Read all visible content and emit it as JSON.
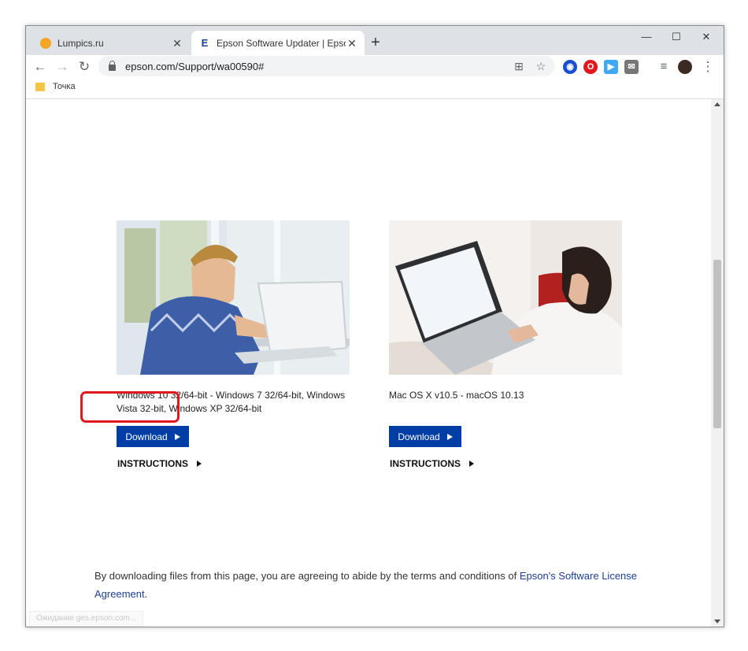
{
  "tabs": [
    {
      "title": "Lumpics.ru",
      "favicon": "lumpics-favicon"
    },
    {
      "title": "Epson Software Updater | Epson",
      "favicon": "epson-favicon",
      "favicon_letter": "E"
    }
  ],
  "window_controls": {
    "minimize": "—",
    "maximize": "☐",
    "close": "✕"
  },
  "toolbar": {
    "url": "epson.com/Support/wa00590#",
    "back": "←",
    "forward": "→",
    "reload": "↻",
    "translate": "⊞",
    "bookmark_star": "☆",
    "menu": "⋮",
    "media": "≡"
  },
  "bookmarks": [
    {
      "label": "Точка"
    }
  ],
  "cards": [
    {
      "os_text": "Windows 10 32/64-bit - Windows 7 32/64-bit, Windows Vista 32-bit, Windows XP 32/64-bit",
      "download_label": "Download",
      "instructions_label": "INSTRUCTIONS"
    },
    {
      "os_text": "Mac OS X v10.5 - macOS 10.13",
      "download_label": "Download",
      "instructions_label": "INSTRUCTIONS"
    }
  ],
  "agreement": {
    "text_before": "By downloading files from this page, you are agreeing to abide by the terms and conditions of ",
    "link_text": "Epson's Software License Agreement",
    "text_after": "."
  },
  "status_bar": "Ожидание ges.epson.com...",
  "colors": {
    "download_button": "#003da5",
    "highlight": "#e0191f",
    "link": "#1c3f94"
  }
}
